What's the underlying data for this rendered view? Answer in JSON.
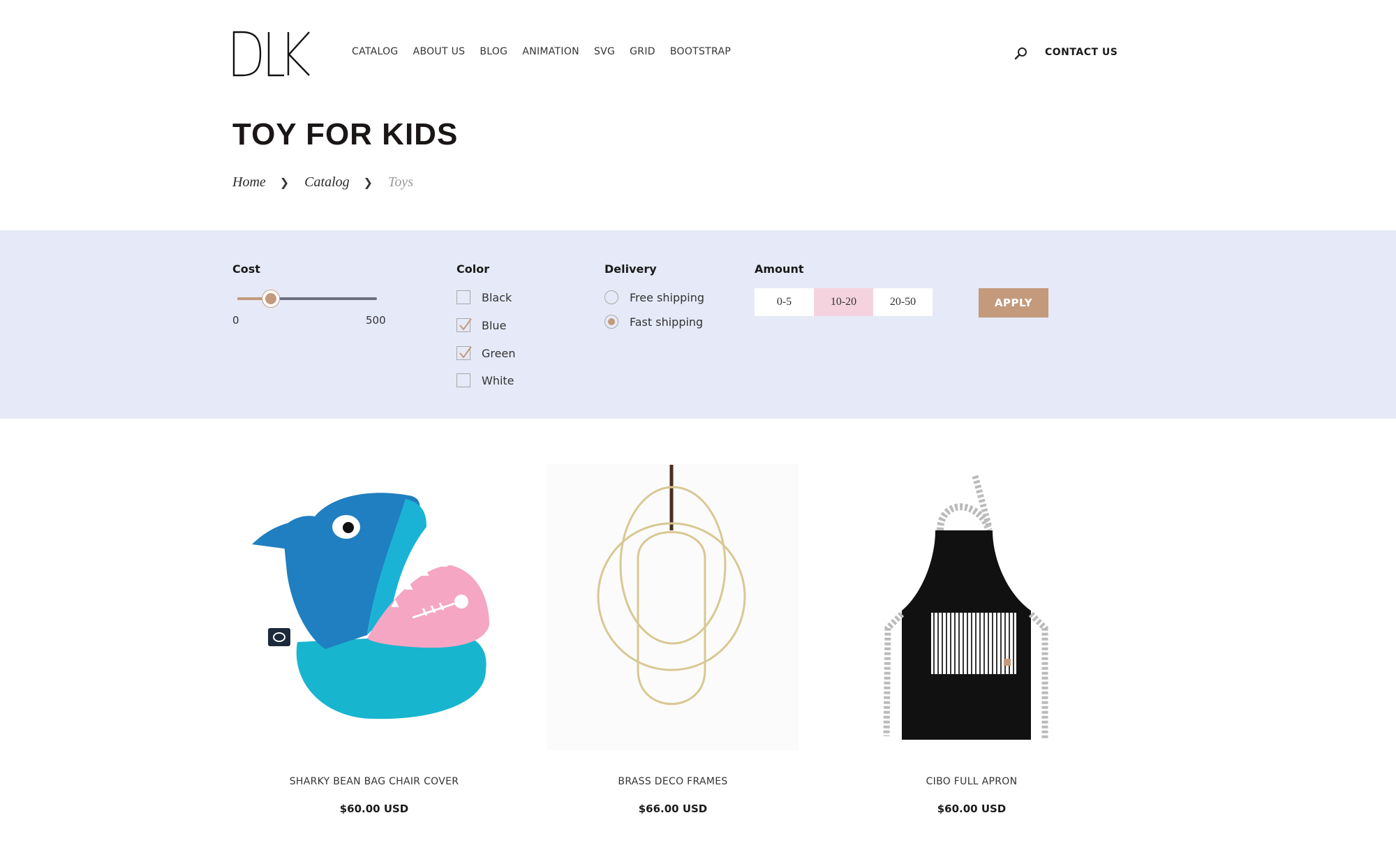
{
  "header": {
    "logo_text": "DLK",
    "nav": [
      "CATALOG",
      "ABOUT US",
      "BLOG",
      "ANIMATION",
      "SVG",
      "GRID",
      "BOOTSTRAP"
    ],
    "contact_label": "CONTACT US",
    "search_icon": "search-icon"
  },
  "page": {
    "title": "TOY FOR KIDS",
    "breadcrumb": [
      "Home",
      "Catalog",
      "Toys"
    ]
  },
  "filters": {
    "cost": {
      "label": "Cost",
      "min_label": "0",
      "max_label": "500",
      "value_fraction": 0.24
    },
    "color": {
      "label": "Color",
      "options": [
        {
          "label": "Black",
          "checked": false
        },
        {
          "label": "Blue",
          "checked": true
        },
        {
          "label": "Green",
          "checked": true
        },
        {
          "label": "White",
          "checked": false
        }
      ]
    },
    "delivery": {
      "label": "Delivery",
      "options": [
        {
          "label": "Free shipping",
          "selected": false
        },
        {
          "label": "Fast shipping",
          "selected": true
        }
      ]
    },
    "amount": {
      "label": "Amount",
      "options": [
        "0-5",
        "10-20",
        "20-50"
      ],
      "active": "10-20"
    },
    "apply_label": "APPLY"
  },
  "products": [
    {
      "name": "SHARKY BEAN BAG CHAIR COVER",
      "price": "$60.00 USD"
    },
    {
      "name": "BRASS DECO FRAMES",
      "price": "$66.00 USD"
    },
    {
      "name": "CIBO FULL APRON",
      "price": "$60.00 USD"
    }
  ],
  "colors": {
    "accent": "#c39a7c",
    "filter_bg": "#e6e9f7",
    "amount_active": "#f5d3de"
  }
}
